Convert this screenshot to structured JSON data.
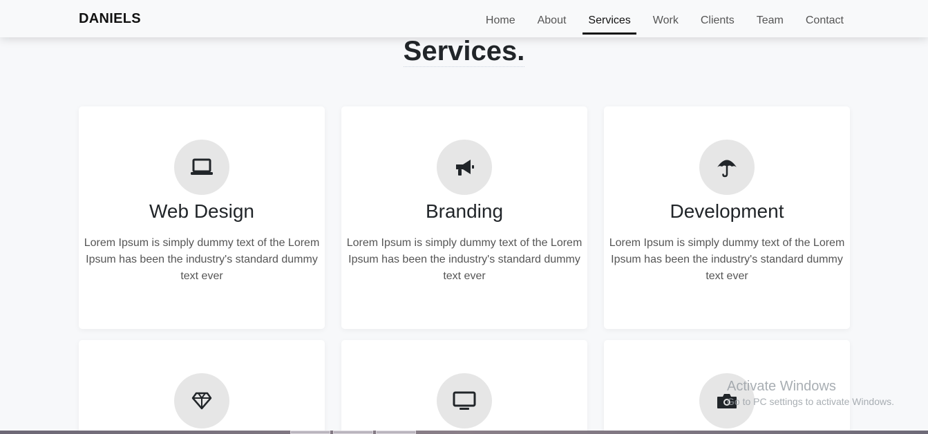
{
  "brand": "DANIELS",
  "nav": [
    {
      "label": "Home",
      "active": false
    },
    {
      "label": "About",
      "active": false
    },
    {
      "label": "Services",
      "active": true
    },
    {
      "label": "Work",
      "active": false
    },
    {
      "label": "Clients",
      "active": false
    },
    {
      "label": "Team",
      "active": false
    },
    {
      "label": "Contact",
      "active": false
    }
  ],
  "section_title": "Services.",
  "services": [
    {
      "title": "Web Design",
      "text": "Lorem Ipsum is simply dummy text of the Lorem Ipsum has been the industry's standard dummy text ever",
      "icon": "laptop-icon"
    },
    {
      "title": "Branding",
      "text": "Lorem Ipsum is simply dummy text of the Lorem Ipsum has been the industry's standard dummy text ever",
      "icon": "megaphone-icon"
    },
    {
      "title": "Development",
      "text": "Lorem Ipsum is simply dummy text of the Lorem Ipsum has been the industry's standard dummy text ever",
      "icon": "umbrella-icon"
    },
    {
      "icon": "diamond-icon"
    },
    {
      "icon": "desktop-icon"
    },
    {
      "icon": "camera-icon"
    }
  ],
  "watermark": {
    "title": "Activate Windows",
    "subtitle": "Go to PC settings to activate Windows."
  },
  "colors": {
    "accent": "#111111",
    "icon_bg": "#e6e6e6",
    "page_bg": "#f7f8fa"
  }
}
